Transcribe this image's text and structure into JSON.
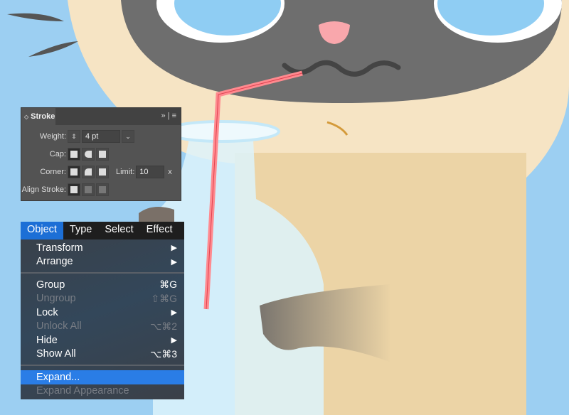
{
  "stroke_panel": {
    "title": "Stroke",
    "expand_icon": "double-chevron-right",
    "menu_icon": "hamburger-icon",
    "weight_label": "Weight:",
    "weight_value": "4 pt",
    "cap_label": "Cap:",
    "corner_label": "Corner:",
    "limit_label": "Limit:",
    "limit_value": "10",
    "limit_unit": "x",
    "align_label": "Align Stroke:"
  },
  "menu": {
    "bar": [
      "Object",
      "Type",
      "Select",
      "Effect"
    ],
    "groups": [
      [
        {
          "label": "Transform",
          "shortcut": "▶",
          "disabled": false
        },
        {
          "label": "Arrange",
          "shortcut": "▶",
          "disabled": false
        }
      ],
      [
        {
          "label": "Group",
          "shortcut": "⌘G",
          "disabled": false
        },
        {
          "label": "Ungroup",
          "shortcut": "⇧⌘G",
          "disabled": true
        },
        {
          "label": "Lock",
          "shortcut": "▶",
          "disabled": false
        },
        {
          "label": "Unlock All",
          "shortcut": "⌥⌘2",
          "disabled": true
        },
        {
          "label": "Hide",
          "shortcut": "▶",
          "disabled": false
        },
        {
          "label": "Show All",
          "shortcut": "⌥⌘3",
          "disabled": false
        }
      ],
      [
        {
          "label": "Expand...",
          "shortcut": "",
          "disabled": false,
          "highlighted": true
        },
        {
          "label": "Expand Appearance",
          "shortcut": "",
          "disabled": true
        }
      ]
    ]
  },
  "colors": {
    "sky": "#9ccff2",
    "face": "#6e6e6e",
    "fur": "#f6e4c4",
    "body": "#ecd4a6",
    "straw": "#ff8a8f",
    "highlight": "#2a7de6"
  }
}
